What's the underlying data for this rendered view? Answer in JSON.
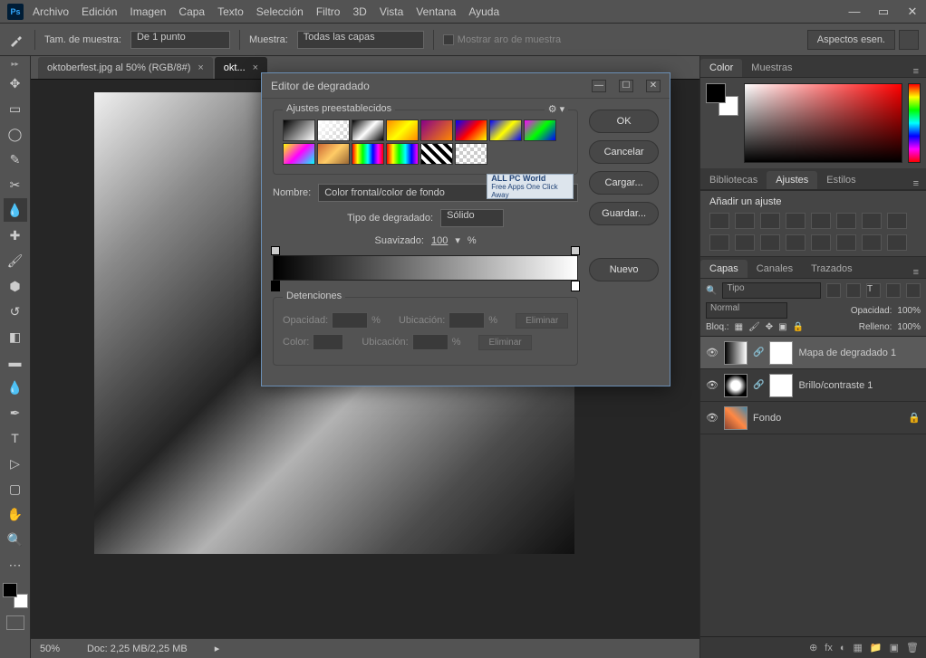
{
  "app": {
    "logo_text": "Ps"
  },
  "winbtns": {
    "min": "—",
    "max": "▭",
    "close": "✕"
  },
  "menu": [
    "Archivo",
    "Edición",
    "Imagen",
    "Capa",
    "Texto",
    "Selección",
    "Filtro",
    "3D",
    "Vista",
    "Ventana",
    "Ayuda"
  ],
  "options": {
    "sample_size_label": "Tam. de muestra:",
    "sample_size_value": "De 1 punto",
    "sample_label": "Muestra:",
    "sample_value": "Todas las capas",
    "show_ring": "Mostrar aro de muestra",
    "right_btn": "Aspectos esen."
  },
  "tabs": [
    {
      "label": "oktoberfest.jpg al 50% (RGB/8#)",
      "close": "×",
      "active": false
    },
    {
      "label": "okt...",
      "close": "×",
      "active": true
    }
  ],
  "status": {
    "zoom": "50%",
    "doc": "Doc: 2,25 MB/2,25 MB",
    "icons": [
      "fx",
      "◐",
      "▦",
      "○",
      "▭",
      "▣",
      "🗑"
    ]
  },
  "panels": {
    "color": {
      "tabs": [
        "Color",
        "Muestras"
      ]
    },
    "adjust": {
      "tabs": [
        "Bibliotecas",
        "Ajustes",
        "Estilos"
      ],
      "title": "Añadir un ajuste"
    },
    "layers": {
      "tabs": [
        "Capas",
        "Canales",
        "Trazados"
      ],
      "kind": "Tipo",
      "blend": "Normal",
      "opacity_label": "Opacidad:",
      "opacity": "100%",
      "lock_label": "Bloq.:",
      "fill_label": "Relleno:",
      "fill": "100%",
      "items": [
        {
          "name": "Mapa de degradado 1",
          "type": "grad"
        },
        {
          "name": "Brillo/contraste 1",
          "type": "sun"
        },
        {
          "name": "Fondo",
          "type": "photo",
          "locked": "🔒"
        }
      ],
      "bottom_icons": [
        "⊕",
        "fx",
        "◐",
        "▦",
        "📁",
        "▣",
        "🗑"
      ]
    }
  },
  "dialog": {
    "title": "Editor de degradado",
    "tb": {
      "min": "—",
      "max": "☐",
      "close": "✕"
    },
    "presets_label": "Ajustes preestablecidos",
    "gear": "⚙ ▾",
    "buttons": {
      "ok": "OK",
      "cancel": "Cancelar",
      "load": "Cargar...",
      "save": "Guardar...",
      "new": "Nuevo"
    },
    "name_label": "Nombre:",
    "name_value": "Color frontal/color de fondo",
    "type_label": "Tipo de degradado:",
    "type_value": "Sólido",
    "smooth_label": "Suavizado:",
    "smooth_value": "100",
    "smooth_pct": "%",
    "stops_label": "Detenciones",
    "opacity_label": "Opacidad:",
    "location_label": "Ubicación:",
    "pct": "%",
    "color_label": "Color:",
    "delete": "Eliminar",
    "watermark_title": "ALL PC World",
    "watermark_sub": "Free Apps One Click Away"
  }
}
